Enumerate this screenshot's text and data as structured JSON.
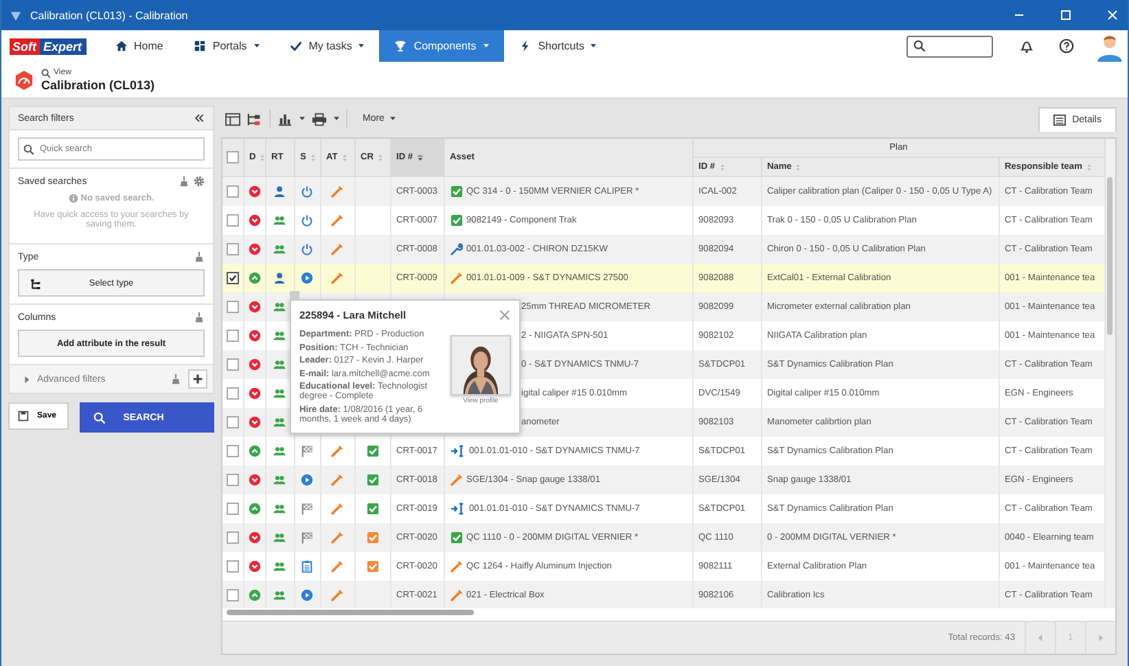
{
  "window": {
    "title": "Calibration (CL013) - Calibration"
  },
  "nav": {
    "logo_a": "Soft",
    "logo_b": "Expert",
    "items": [
      {
        "label": "Home",
        "dropdown": false,
        "selected": false
      },
      {
        "label": "Portals",
        "dropdown": true,
        "selected": false
      },
      {
        "label": "My tasks",
        "dropdown": true,
        "selected": false
      },
      {
        "label": "Components",
        "dropdown": true,
        "selected": true
      },
      {
        "label": "Shortcuts",
        "dropdown": true,
        "selected": false
      }
    ]
  },
  "page": {
    "mode": "View",
    "title": "Calibration (CL013)"
  },
  "filters": {
    "title": "Search filters",
    "search_placeholder": "Quick search",
    "saved": {
      "title": "Saved searches",
      "empty_title": "No saved search.",
      "empty_text": "Have quick access to your searches by saving them."
    },
    "type": {
      "title": "Type",
      "button": "Select type"
    },
    "columns": {
      "title": "Columns",
      "button": "Add attribute in the result"
    },
    "advanced": {
      "title": "Advanced filters",
      "expanded": false
    },
    "save_button": "Save",
    "search_button": "SEARCH"
  },
  "toolbar": {
    "more": "More",
    "details_tab": "Details"
  },
  "table": {
    "group": "Plan",
    "all_selected": false,
    "columns": [
      {
        "label": "D",
        "kind": "sortable"
      },
      {
        "label": "RT",
        "kind": "plain"
      },
      {
        "label": "S",
        "kind": "sortable"
      },
      {
        "label": "AT",
        "kind": "sortable"
      },
      {
        "label": "CR",
        "kind": "sortable"
      },
      {
        "label": "ID #",
        "kind": "sorted"
      },
      {
        "label": "Asset",
        "kind": "plain"
      }
    ],
    "plan_columns": [
      {
        "label": "ID #",
        "kind": "sortable"
      },
      {
        "label": "Name",
        "kind": "sortable"
      },
      {
        "label": "Responsible team",
        "kind": "sortable"
      }
    ],
    "rows": [
      {
        "selected": false,
        "d": {
          "kind": "down"
        },
        "rt": {
          "kind": "person"
        },
        "s": {
          "kind": "power"
        },
        "at": {
          "kind": "pencil"
        },
        "id": "CRT-0003",
        "asset": {
          "kind": "check",
          "text": "QC 314 - 0 - 150MM VERNIER CALIPER *"
        },
        "plan_id": "ICAL-002",
        "name": "Caliper calibration plan (Caliper 0 - 150 - 0,05 U Type A)",
        "team": "CT - Calibration Team"
      },
      {
        "selected": false,
        "d": {
          "kind": "down"
        },
        "rt": {
          "kind": "group"
        },
        "s": {
          "kind": "power"
        },
        "at": {
          "kind": "pencil"
        },
        "id": "CRT-0007",
        "asset": {
          "kind": "check",
          "text": "9082149 - Component Trak"
        },
        "plan_id": "9082093",
        "name": "Trak 0 - 150 - 0,05 U Calibration Plan",
        "team": "CT - Calibration Team"
      },
      {
        "selected": false,
        "d": {
          "kind": "down"
        },
        "rt": {
          "kind": "group"
        },
        "s": {
          "kind": "power"
        },
        "at": {
          "kind": "pencil"
        },
        "id": "CRT-0008",
        "asset": {
          "kind": "wrench",
          "text": "001.01.03-002 - CHIRON DZ15KW"
        },
        "plan_id": "9082094",
        "name": "Chiron 0 - 150 - 0,05 U Calibration Plan",
        "team": "CT - Calibration Team"
      },
      {
        "selected": true,
        "d": {
          "kind": "up"
        },
        "rt": {
          "kind": "person"
        },
        "s": {
          "kind": "play"
        },
        "at": {
          "kind": "pencil"
        },
        "id": "CRT-0009",
        "asset": {
          "kind": "pencil",
          "text": "001.01.01-009 - S&T DYNAMICS 27500"
        },
        "plan_id": "9082088",
        "name": "ExtCal01 - External Calibration",
        "team": "001 - Maintenance tea"
      },
      {
        "selected": false,
        "d": {
          "kind": "down"
        },
        "rt": {
          "kind": "group"
        },
        "asset": {
          "kind": "covered",
          "text": "25mm THREAD MICROMETER"
        },
        "plan_id": "9082099",
        "name": "Micrometer external calibration plan",
        "team": "001 - Maintenance tea"
      },
      {
        "selected": false,
        "d": {
          "kind": "down"
        },
        "rt": {
          "kind": "group"
        },
        "asset": {
          "kind": "covered",
          "text": "2 - NIIGATA SPN-501"
        },
        "plan_id": "9082102",
        "name": "NIIGATA Calibration plan",
        "team": "001 - Maintenance tea"
      },
      {
        "selected": false,
        "d": {
          "kind": "down"
        },
        "rt": {
          "kind": "group"
        },
        "asset": {
          "kind": "covered",
          "text": "0 - S&T DYNAMICS TNMU-7"
        },
        "plan_id": "S&TDCP01",
        "name": "S&T Dynamics Calibration Plan",
        "team": "CT - Calibration Team"
      },
      {
        "selected": false,
        "d": {
          "kind": "down"
        },
        "rt": {
          "kind": "group"
        },
        "asset": {
          "kind": "covered",
          "text": "igital caliper #15 0.010mm"
        },
        "plan_id": "DVC/1549",
        "name": "Digital caliper #15 0.010mm",
        "team": "EGN - Engineers"
      },
      {
        "selected": false,
        "d": {
          "kind": "down"
        },
        "rt": {
          "kind": "group"
        },
        "asset": {
          "kind": "covered",
          "text": "anometer"
        },
        "plan_id": "9082103",
        "name": "Manometer calibrtion plan",
        "team": "CT - Calibration Team"
      },
      {
        "selected": false,
        "d": {
          "kind": "up"
        },
        "rt": {
          "kind": "group"
        },
        "s": {
          "kind": "flag"
        },
        "at": {
          "kind": "pencil"
        },
        "cr": {
          "kind": "approved"
        },
        "id": "CRT-0017",
        "asset": {
          "kind": "transfer",
          "text": "001.01.01-010 - S&T DYNAMICS TNMU-7"
        },
        "plan_id": "S&TDCP01",
        "name": "S&T Dynamics Calibration Plan",
        "team": "CT - Calibration Team"
      },
      {
        "selected": false,
        "d": {
          "kind": "down"
        },
        "rt": {
          "kind": "group"
        },
        "s": {
          "kind": "play"
        },
        "at": {
          "kind": "pencil"
        },
        "cr": {
          "kind": "approved"
        },
        "id": "CRT-0018",
        "asset": {
          "kind": "pencil",
          "text": "SGE/1304 - Snap gauge 1338/01"
        },
        "plan_id": "SGE/1304",
        "name": "Snap gauge 1338/01",
        "team": "EGN - Engineers"
      },
      {
        "selected": false,
        "d": {
          "kind": "up"
        },
        "rt": {
          "kind": "group"
        },
        "s": {
          "kind": "flag"
        },
        "at": {
          "kind": "pencil"
        },
        "cr": {
          "kind": "approved"
        },
        "id": "CRT-0019",
        "asset": {
          "kind": "transfer",
          "text": "001.01.01-010 - S&T DYNAMICS TNMU-7"
        },
        "plan_id": "S&TDCP01",
        "name": "S&T Dynamics Calibration Plan",
        "team": "CT - Calibration Team"
      },
      {
        "selected": false,
        "d": {
          "kind": "down"
        },
        "rt": {
          "kind": "group"
        },
        "s": {
          "kind": "flag"
        },
        "at": {
          "kind": "pencil"
        },
        "cr": {
          "kind": "pending"
        },
        "id": "CRT-0020",
        "asset": {
          "kind": "check",
          "text": "QC 1110 - 0 - 200MM DIGITAL VERNIER *"
        },
        "plan_id": "QC 1110",
        "name": "0 - 200MM DIGITAL VERNIER *",
        "team": "0040 - Elearning team"
      },
      {
        "selected": false,
        "d": {
          "kind": "down"
        },
        "rt": {
          "kind": "group"
        },
        "s": {
          "kind": "clipboard"
        },
        "at": {
          "kind": "pencil"
        },
        "cr": {
          "kind": "pending"
        },
        "id": "CRT-0020",
        "asset": {
          "kind": "pencil",
          "text": "QC 1264 - Haifly Aluminum Injection"
        },
        "plan_id": "9082111",
        "name": "External Calibration Plan",
        "team": "001 - Maintenance tea"
      },
      {
        "selected": false,
        "d": {
          "kind": "up"
        },
        "rt": {
          "kind": "group"
        },
        "s": {
          "kind": "play"
        },
        "at": {
          "kind": "pencil"
        },
        "id": "CRT-0021",
        "asset": {
          "kind": "pencil",
          "text": "021 - Electrical Box"
        },
        "plan_id": "9082106",
        "name": "Calibration Ics",
        "team": "CT - Calibration Team"
      }
    ],
    "total": "Total records: 43",
    "page": "1"
  },
  "popup": {
    "title": "225894 - Lara Mitchell",
    "fields": [
      {
        "label": "Department:",
        "value": "PRD - Production"
      },
      {
        "label": "Position:",
        "value": "TCH - Technician"
      },
      {
        "label": "Leader:",
        "value": "0127 - Kevin J. Harper"
      },
      {
        "label": "E-mail:",
        "value": "lara.mitchell@acme.com"
      },
      {
        "label": "Educational level:",
        "value": "Technologist degree - Complete"
      },
      {
        "label": "Hire date:",
        "value": "1/08/2016 (1 year, 6 months, 1 week and 4 days)"
      }
    ],
    "photo_caption": "View profile"
  }
}
